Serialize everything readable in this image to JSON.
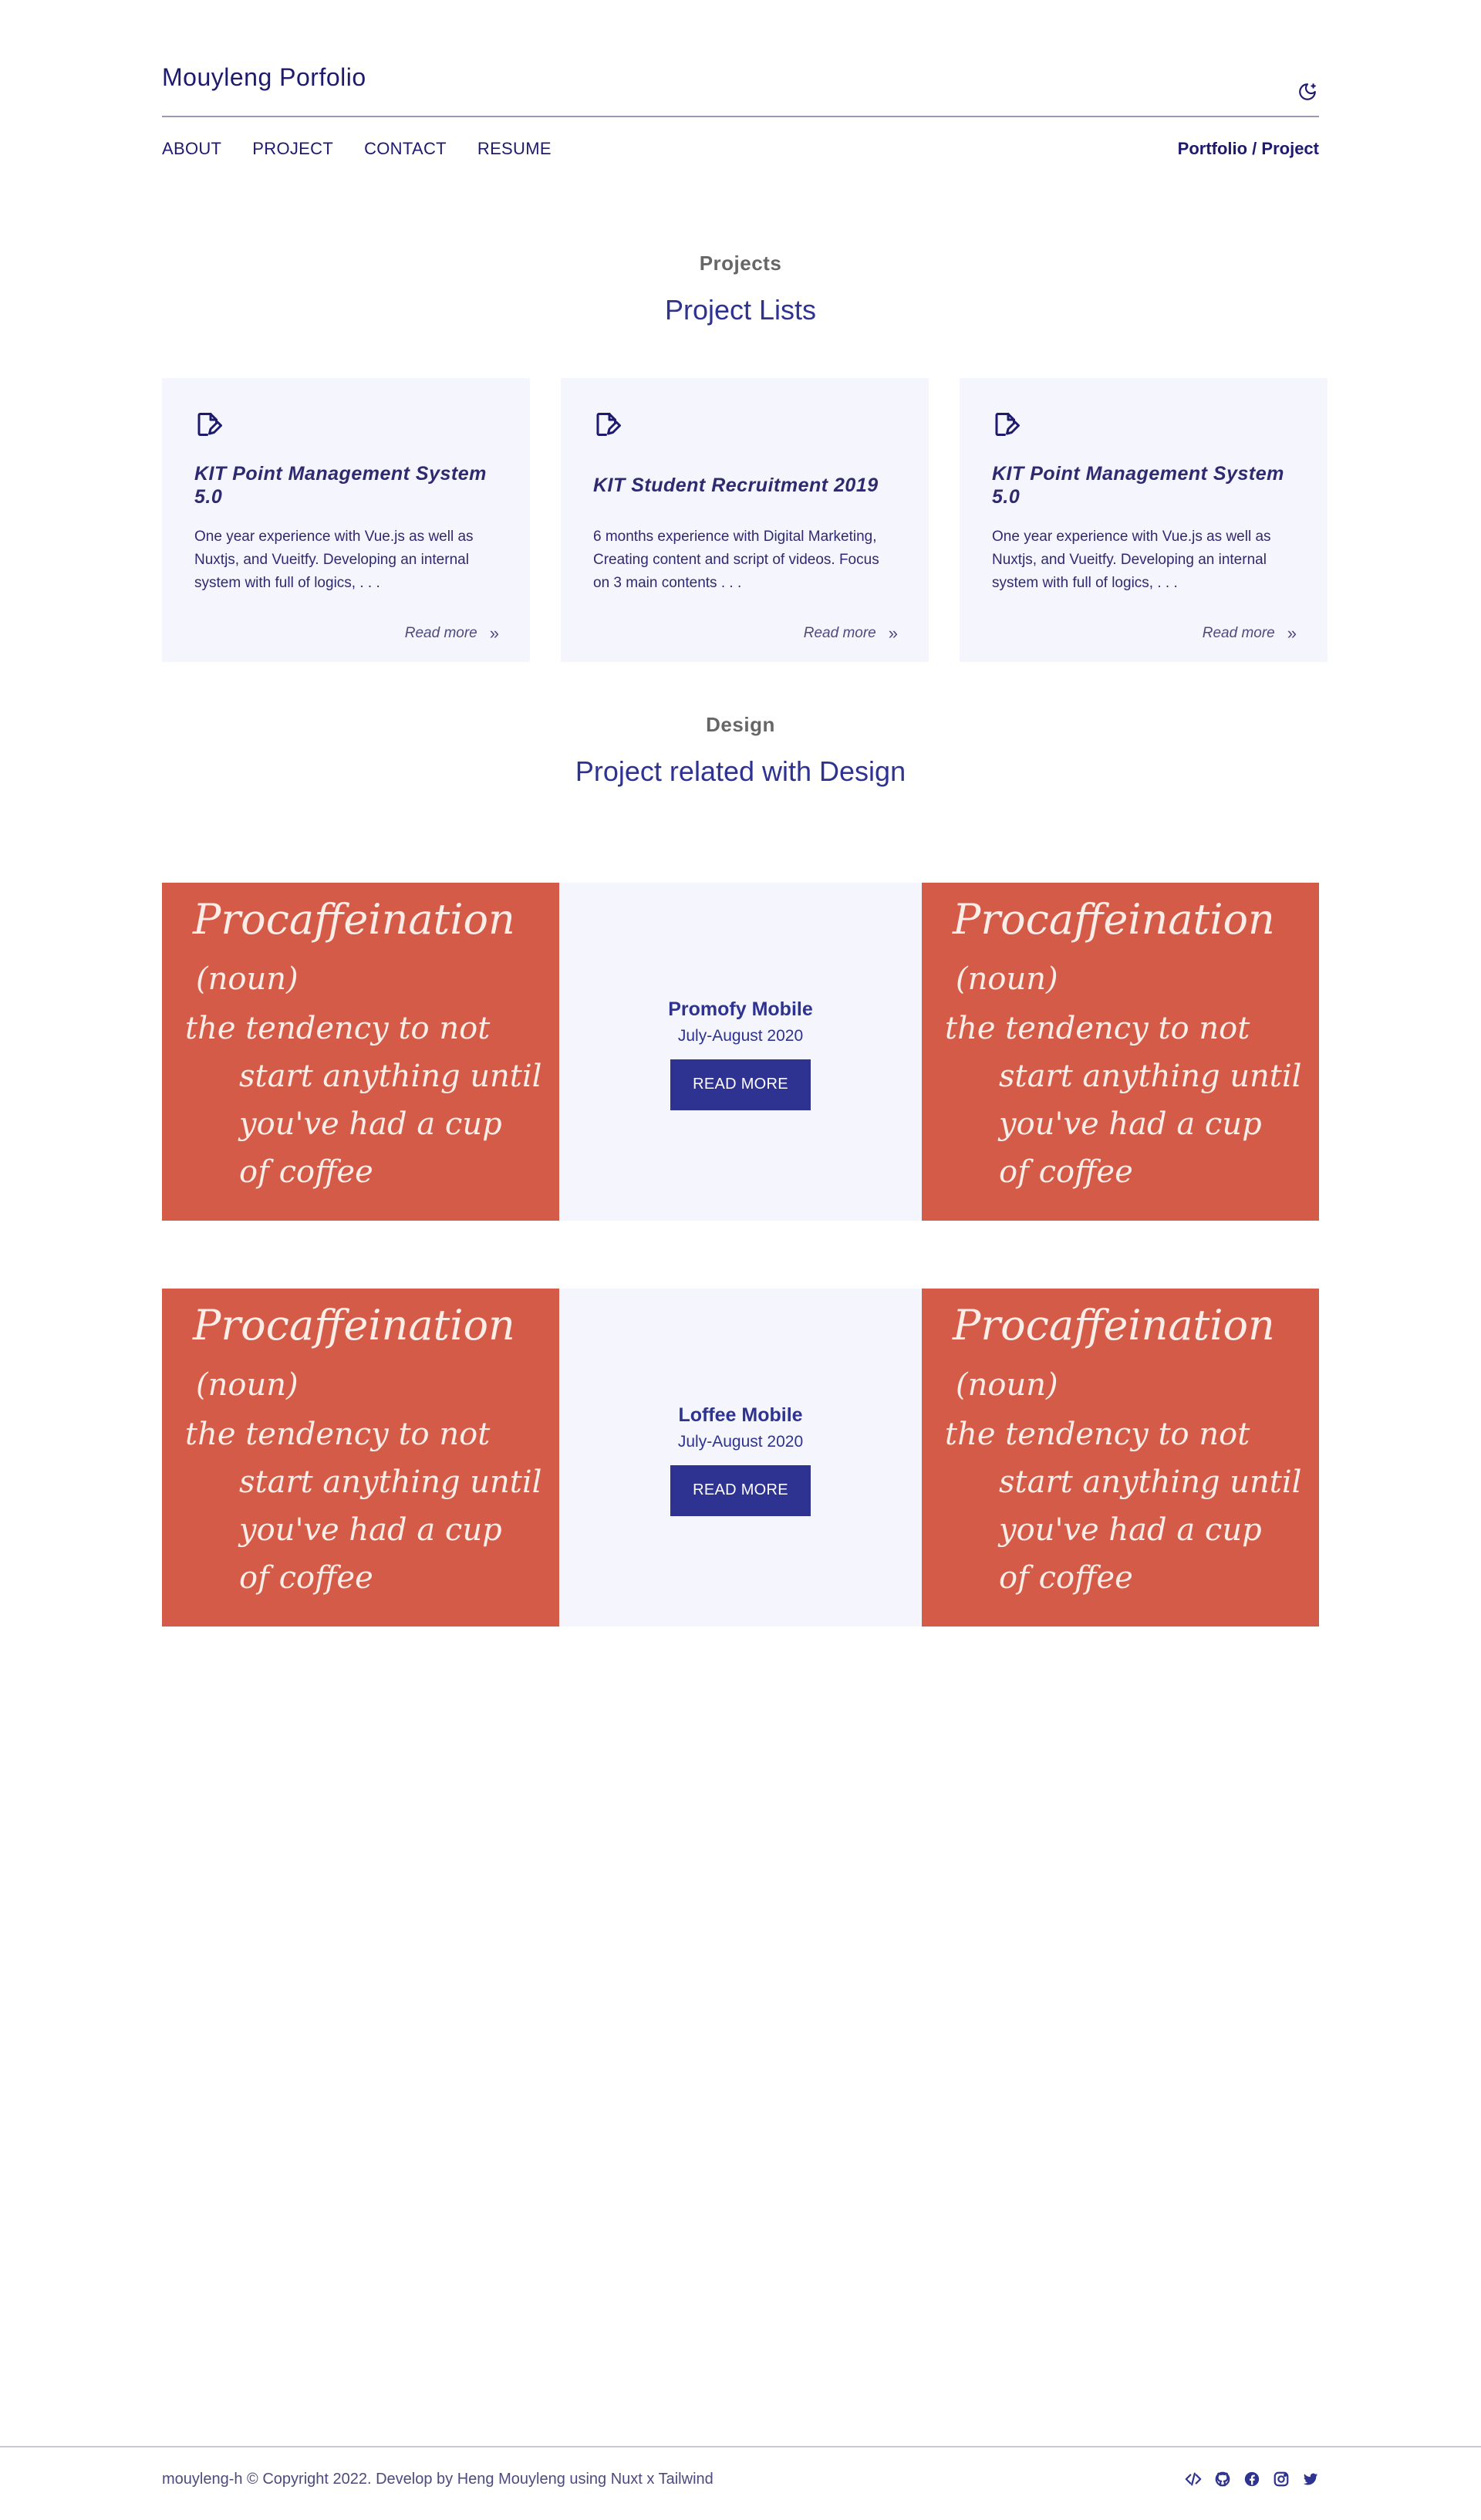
{
  "header": {
    "brand": "Mouyleng Porfolio",
    "nav": [
      "ABOUT",
      "PROJECT",
      "CONTACT",
      "RESUME"
    ],
    "breadcrumb": "Portfolio / Project",
    "theme_icon": "moon-icon"
  },
  "projects": {
    "eyebrow": "Projects",
    "title": "Project Lists",
    "cards": [
      {
        "title": "KIT Point Management System 5.0",
        "description": "One year experience with Vue.js as well as Nuxtjs, and Vueitfy. Developing an internal system with full of logics, . . .",
        "read_more": "Read more",
        "icon": "edit-document-icon"
      },
      {
        "title": "KIT Student Recruitment 2019",
        "description": "6 months experience with Digital Marketing, Creating content and script of videos. Focus on 3 main contents . . .",
        "read_more": "Read more",
        "icon": "edit-document-icon"
      },
      {
        "title": "KIT Point Management System 5.0",
        "description": "One year experience with Vue.js as well as Nuxtjs, and Vueitfy. Developing an internal system with full of logics, . . .",
        "read_more": "Read more",
        "icon": "edit-document-icon"
      }
    ]
  },
  "design": {
    "eyebrow": "Design",
    "title": "Project related with Design",
    "image_text": {
      "line1": "Procaffeination",
      "line2": "(noun)",
      "line3": "the tendency to not",
      "line4": "start anything until",
      "line5": "you've had a cup",
      "line6": "of coffee"
    },
    "items": [
      {
        "title": "Promofy Mobile",
        "date": "July-August 2020",
        "button": "READ MORE"
      },
      {
        "title": "Loffee Mobile",
        "date": "July-August 2020",
        "button": "READ MORE"
      }
    ]
  },
  "footer": {
    "copyright": "mouyleng-h © Copyright 2022. Develop by Heng Mouyleng using Nuxt x Tailwind",
    "socials": [
      "code-icon",
      "github-icon",
      "facebook-icon",
      "instagram-icon",
      "twitter-icon"
    ]
  },
  "colors": {
    "primary": "#2e3391",
    "card_bg": "#f4f5fd",
    "image_bg": "#d45b47"
  }
}
